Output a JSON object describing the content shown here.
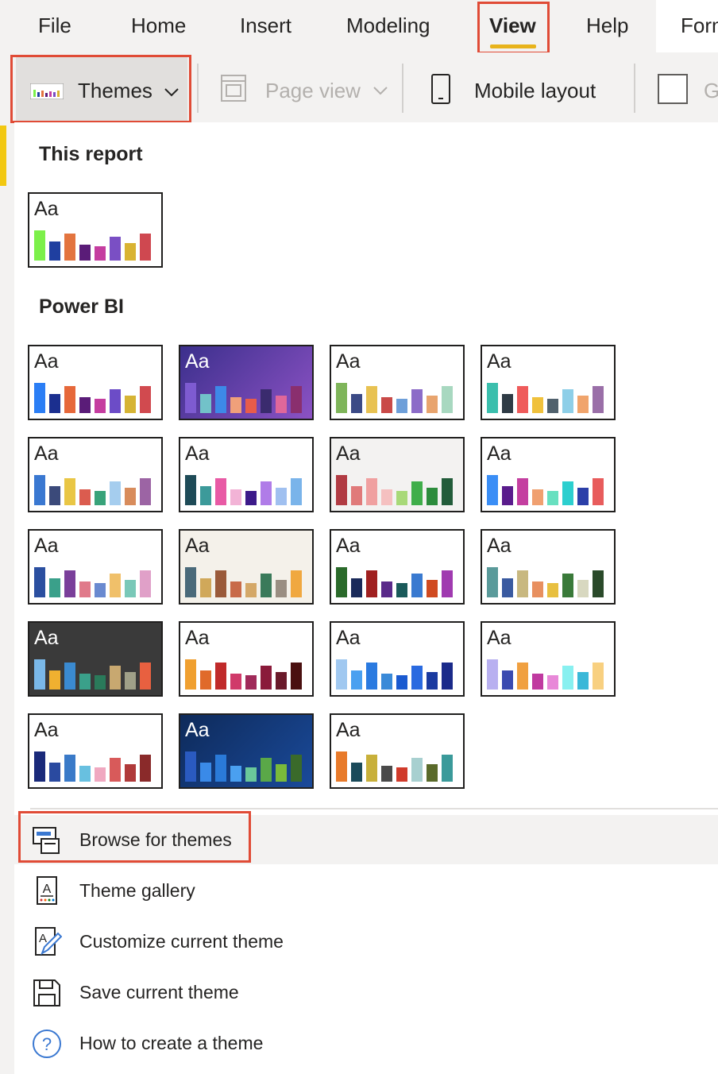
{
  "menubar": {
    "items": [
      "File",
      "Home",
      "Insert",
      "Modeling",
      "View",
      "Help"
    ],
    "active": "View",
    "partial_tab": "Form"
  },
  "ribbon": {
    "themes_label": "Themes",
    "page_view_label": "Page view",
    "mobile_layout_label": "Mobile layout",
    "partial_label": "G"
  },
  "panel": {
    "this_report_title": "This report",
    "power_bi_title": "Power BI",
    "sample_text": "Aa",
    "this_report_theme": {
      "bg": "#ffffff",
      "text": "#252423",
      "colors": [
        "#7cf04a",
        "#1f3fa0",
        "#e3743f",
        "#5a1c78",
        "#c53da0",
        "#7a4fc4",
        "#d9b332",
        "#cf4850"
      ]
    },
    "themes": [
      {
        "bg": "#ffffff",
        "text": "#252423",
        "colors": [
          "#2b7ef5",
          "#1b2f8f",
          "#e6683a",
          "#5a1c78",
          "#c53da0",
          "#6c4cc7",
          "#d6b434",
          "#d14a4f"
        ]
      },
      {
        "bg": "linear-gradient(135deg,#3b2f8c,#8c52c4)",
        "text": "#ffffff",
        "colors": [
          "#7e5bd1",
          "#72c2c9",
          "#3d89e8",
          "#f0a07a",
          "#e85c4a",
          "#3a2b6e",
          "#e0679a",
          "#8a2f6e"
        ]
      },
      {
        "bg": "#ffffff",
        "text": "#252423",
        "colors": [
          "#7fb55a",
          "#3b4a86",
          "#e8c252",
          "#c94a48",
          "#6e9fd9",
          "#8c6cc8",
          "#e8a46e",
          "#a8d8c0"
        ]
      },
      {
        "bg": "#ffffff",
        "text": "#252423",
        "colors": [
          "#3bbfad",
          "#2f3b45",
          "#ef5b5b",
          "#f0c13c",
          "#50616d",
          "#8ecfe8",
          "#f0a46c",
          "#9a6fa8"
        ]
      },
      {
        "bg": "#ffffff",
        "text": "#252423",
        "colors": [
          "#3a78d1",
          "#3b4a7a",
          "#e9c645",
          "#db5c4f",
          "#38a37a",
          "#a5cdee",
          "#d88c5c",
          "#9c64a4"
        ]
      },
      {
        "bg": "#ffffff",
        "text": "#252423",
        "colors": [
          "#1e4b57",
          "#3c9a9a",
          "#e85aa5",
          "#f2b3d6",
          "#3c1a8a",
          "#b07ce8",
          "#a0c0f0",
          "#7ab4ea"
        ]
      },
      {
        "bg": "#f3f2f1",
        "text": "#252423",
        "colors": [
          "#b13b43",
          "#e07a7a",
          "#f0a0a0",
          "#f5c0c0",
          "#a8d978",
          "#3fae4a",
          "#2c8c3c",
          "#225c3a"
        ]
      },
      {
        "bg": "#ffffff",
        "text": "#252423",
        "colors": [
          "#3a8ef6",
          "#5a1c8c",
          "#c43fa0",
          "#f0a070",
          "#68e0c0",
          "#2ccfcf",
          "#2b3fa8",
          "#e85c5c"
        ]
      },
      {
        "bg": "#ffffff",
        "text": "#252423",
        "colors": [
          "#2b4fa0",
          "#3aa08a",
          "#7a3f9a",
          "#e07a8a",
          "#6a8ad0",
          "#f0c06a",
          "#7ac8b8",
          "#e0a0c8"
        ]
      },
      {
        "bg": "#f4f1ea",
        "text": "#252423",
        "colors": [
          "#4a6a7a",
          "#d0a85a",
          "#9a5a3a",
          "#c86a48",
          "#d4a868",
          "#3a7a5a",
          "#9a8e82",
          "#f0a840"
        ]
      },
      {
        "bg": "#ffffff",
        "text": "#252423",
        "colors": [
          "#2a6a2a",
          "#1a2a5a",
          "#a02020",
          "#5a2a8a",
          "#1a5a5a",
          "#3a7ad0",
          "#d04a20",
          "#a03ab0"
        ]
      },
      {
        "bg": "#ffffff",
        "text": "#252423",
        "colors": [
          "#5a9a9a",
          "#3a5aa0",
          "#c8b880",
          "#e89060",
          "#e8c040",
          "#3a7a3a",
          "#d8d8c0",
          "#2a4a2a"
        ]
      },
      {
        "bg": "#3a3a3a",
        "text": "#ffffff",
        "colors": [
          "#7ab8e8",
          "#f0b030",
          "#3a8ad0",
          "#3aa08a",
          "#2a7a5a",
          "#c8a870",
          "#a0a088",
          "#e86040"
        ]
      },
      {
        "bg": "#ffffff",
        "text": "#252423",
        "colors": [
          "#f0a030",
          "#e06a2a",
          "#c02a2a",
          "#d03a6a",
          "#a02a5a",
          "#8a1a3a",
          "#6a1a2a",
          "#4a1010"
        ]
      },
      {
        "bg": "#ffffff",
        "text": "#252423",
        "colors": [
          "#a0c8f0",
          "#4aa0f0",
          "#2a7ae0",
          "#3a8ad8",
          "#1a5ad0",
          "#2a6ae0",
          "#1a3aa0",
          "#1a2a8a"
        ]
      },
      {
        "bg": "#ffffff",
        "text": "#252423",
        "colors": [
          "#b8b0f0",
          "#3a4ab0",
          "#f0a040",
          "#c03aa0",
          "#e888d8",
          "#88f0f0",
          "#3ab8d8",
          "#f8d080"
        ]
      },
      {
        "bg": "#ffffff",
        "text": "#252423",
        "colors": [
          "#1a2a7a",
          "#2a4aa0",
          "#3a7ac8",
          "#68c0e0",
          "#f0a8c0",
          "#d85a5a",
          "#b03a3a",
          "#8a2a2a"
        ]
      },
      {
        "bg": "linear-gradient(135deg,#0e2a5a,#1a4a9a)",
        "text": "#ffffff",
        "colors": [
          "#2a5ac0",
          "#3a8ae8",
          "#2a7ad8",
          "#4aa0f0",
          "#6ac89a",
          "#5aa848",
          "#7aba3a",
          "#3a6a2a"
        ]
      },
      {
        "bg": "#ffffff",
        "text": "#252423",
        "colors": [
          "#e87a2a",
          "#1a4a5a",
          "#c8b03a",
          "#4a4a4a",
          "#d03a2a",
          "#a8d0d0",
          "#5a6a2a",
          "#3a9a9a"
        ]
      }
    ]
  },
  "actions": [
    {
      "label": "Browse for themes",
      "icon": "browse-themes-icon"
    },
    {
      "label": "Theme gallery",
      "icon": "theme-gallery-icon"
    },
    {
      "label": "Customize current theme",
      "icon": "customize-theme-icon"
    },
    {
      "label": "Save current theme",
      "icon": "save-theme-icon"
    },
    {
      "label": "How to create a theme",
      "icon": "help-icon"
    }
  ],
  "colors": {
    "highlight": "#e04b36",
    "active_underline": "#e8b31b",
    "accent_yellow": "#f2c811"
  }
}
